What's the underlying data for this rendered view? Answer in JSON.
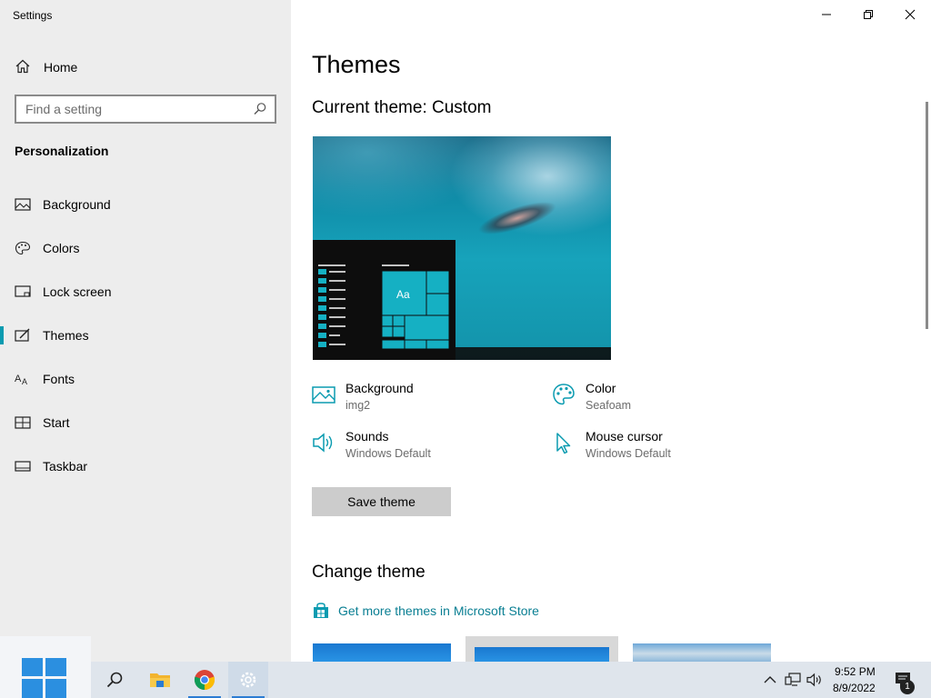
{
  "window": {
    "title": "Settings",
    "controls": [
      "minimize",
      "maximize",
      "close"
    ]
  },
  "sidebar": {
    "home_label": "Home",
    "search_placeholder": "Find a setting",
    "section_title": "Personalization",
    "items": [
      {
        "label": "Background",
        "icon": "image-icon"
      },
      {
        "label": "Colors",
        "icon": "palette-icon"
      },
      {
        "label": "Lock screen",
        "icon": "lock-screen-icon"
      },
      {
        "label": "Themes",
        "icon": "brush-icon",
        "active": true
      },
      {
        "label": "Fonts",
        "icon": "font-icon"
      },
      {
        "label": "Start",
        "icon": "start-grid-icon"
      },
      {
        "label": "Taskbar",
        "icon": "taskbar-icon"
      }
    ]
  },
  "main": {
    "title": "Themes",
    "current_theme": "Current theme: Custom",
    "preview_tile_label": "Aa",
    "options": {
      "background": {
        "title": "Background",
        "value": "img2"
      },
      "color": {
        "title": "Color",
        "value": "Seafoam"
      },
      "sounds": {
        "title": "Sounds",
        "value": "Windows Default"
      },
      "cursor": {
        "title": "Mouse cursor",
        "value": "Windows Default"
      }
    },
    "save_button": "Save theme",
    "change_theme_title": "Change theme",
    "store_link": "Get more themes in Microsoft Store"
  },
  "colors": {
    "accent": "#0a9bb0",
    "link": "#0a7f93",
    "sidebar_bg": "#ededed",
    "taskbar_bg": "#dfe5ec"
  },
  "taskbar": {
    "time": "9:52 PM",
    "date": "8/9/2022",
    "notification_count": "1",
    "apps": [
      "windows-start-icon",
      "search-icon",
      "file-explorer-icon",
      "chrome-icon",
      "settings-icon"
    ]
  }
}
